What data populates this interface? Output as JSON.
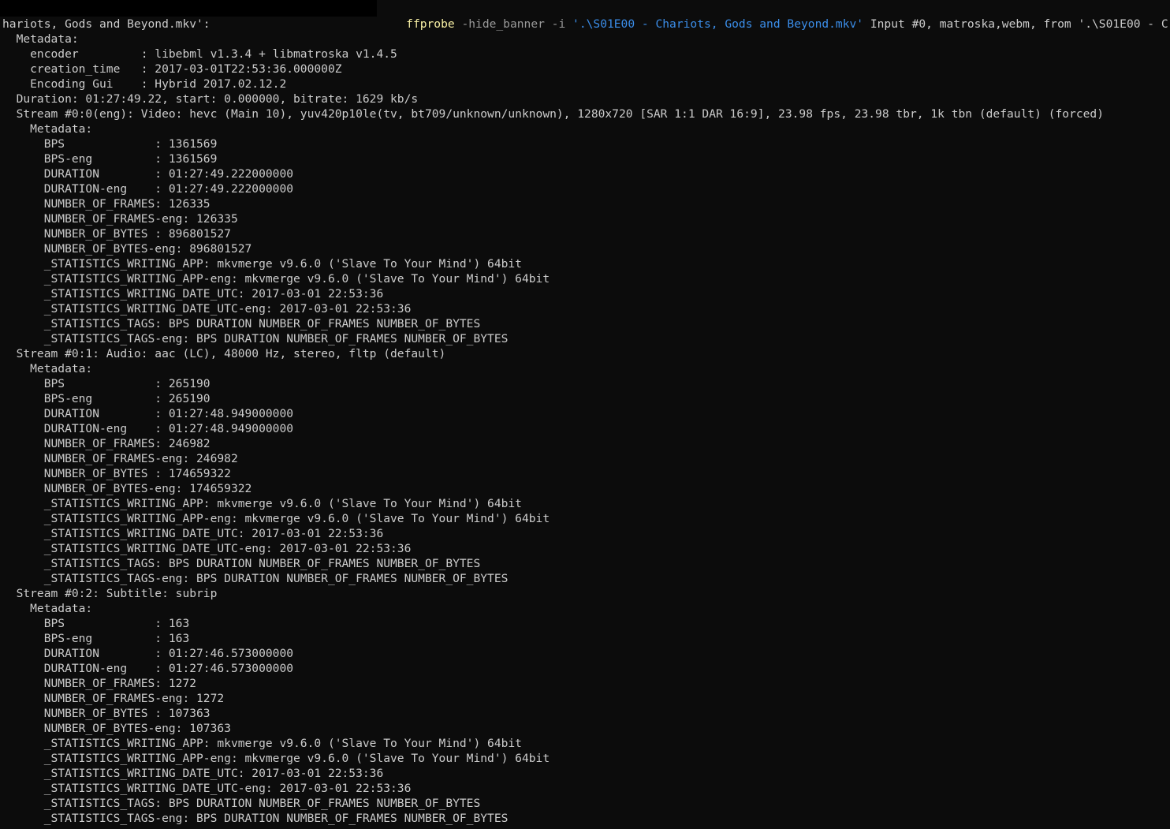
{
  "command_line": {
    "command": "ffprobe",
    "args": " -hide_banner -i ",
    "path": "'.\\S01E00 - Chariots, Gods and Beyond.mkv'",
    "output_start": " Input #0, matroska,webm, from '.\\S01E00 - C"
  },
  "lines": [
    "hariots, Gods and Beyond.mkv':",
    "  Metadata:",
    "    encoder         : libebml v1.3.4 + libmatroska v1.4.5",
    "    creation_time   : 2017-03-01T22:53:36.000000Z",
    "    Encoding Gui    : Hybrid 2017.02.12.2",
    "  Duration: 01:27:49.22, start: 0.000000, bitrate: 1629 kb/s",
    "  Stream #0:0(eng): Video: hevc (Main 10), yuv420p10le(tv, bt709/unknown/unknown), 1280x720 [SAR 1:1 DAR 16:9], 23.98 fps, 23.98 tbr, 1k tbn (default) (forced)",
    "    Metadata:",
    "      BPS             : 1361569",
    "      BPS-eng         : 1361569",
    "      DURATION        : 01:27:49.222000000",
    "      DURATION-eng    : 01:27:49.222000000",
    "      NUMBER_OF_FRAMES: 126335",
    "      NUMBER_OF_FRAMES-eng: 126335",
    "      NUMBER_OF_BYTES : 896801527",
    "      NUMBER_OF_BYTES-eng: 896801527",
    "      _STATISTICS_WRITING_APP: mkvmerge v9.6.0 ('Slave To Your Mind') 64bit",
    "      _STATISTICS_WRITING_APP-eng: mkvmerge v9.6.0 ('Slave To Your Mind') 64bit",
    "      _STATISTICS_WRITING_DATE_UTC: 2017-03-01 22:53:36",
    "      _STATISTICS_WRITING_DATE_UTC-eng: 2017-03-01 22:53:36",
    "      _STATISTICS_TAGS: BPS DURATION NUMBER_OF_FRAMES NUMBER_OF_BYTES",
    "      _STATISTICS_TAGS-eng: BPS DURATION NUMBER_OF_FRAMES NUMBER_OF_BYTES",
    "  Stream #0:1: Audio: aac (LC), 48000 Hz, stereo, fltp (default)",
    "    Metadata:",
    "      BPS             : 265190",
    "      BPS-eng         : 265190",
    "      DURATION        : 01:27:48.949000000",
    "      DURATION-eng    : 01:27:48.949000000",
    "      NUMBER_OF_FRAMES: 246982",
    "      NUMBER_OF_FRAMES-eng: 246982",
    "      NUMBER_OF_BYTES : 174659322",
    "      NUMBER_OF_BYTES-eng: 174659322",
    "      _STATISTICS_WRITING_APP: mkvmerge v9.6.0 ('Slave To Your Mind') 64bit",
    "      _STATISTICS_WRITING_APP-eng: mkvmerge v9.6.0 ('Slave To Your Mind') 64bit",
    "      _STATISTICS_WRITING_DATE_UTC: 2017-03-01 22:53:36",
    "      _STATISTICS_WRITING_DATE_UTC-eng: 2017-03-01 22:53:36",
    "      _STATISTICS_TAGS: BPS DURATION NUMBER_OF_FRAMES NUMBER_OF_BYTES",
    "      _STATISTICS_TAGS-eng: BPS DURATION NUMBER_OF_FRAMES NUMBER_OF_BYTES",
    "  Stream #0:2: Subtitle: subrip",
    "    Metadata:",
    "      BPS             : 163",
    "      BPS-eng         : 163",
    "      DURATION        : 01:27:46.573000000",
    "      DURATION-eng    : 01:27:46.573000000",
    "      NUMBER_OF_FRAMES: 1272",
    "      NUMBER_OF_FRAMES-eng: 1272",
    "      NUMBER_OF_BYTES : 107363",
    "      NUMBER_OF_BYTES-eng: 107363",
    "      _STATISTICS_WRITING_APP: mkvmerge v9.6.0 ('Slave To Your Mind') 64bit",
    "      _STATISTICS_WRITING_APP-eng: mkvmerge v9.6.0 ('Slave To Your Mind') 64bit",
    "      _STATISTICS_WRITING_DATE_UTC: 2017-03-01 22:53:36",
    "      _STATISTICS_WRITING_DATE_UTC-eng: 2017-03-01 22:53:36",
    "      _STATISTICS_TAGS: BPS DURATION NUMBER_OF_FRAMES NUMBER_OF_BYTES",
    "      _STATISTICS_TAGS-eng: BPS DURATION NUMBER_OF_FRAMES NUMBER_OF_BYTES"
  ],
  "colors": {
    "background": "#0c0c0c",
    "foreground": "#cccccc",
    "command": "#f9f1a5",
    "argument": "#9a9a9a",
    "string": "#3b8eea"
  }
}
